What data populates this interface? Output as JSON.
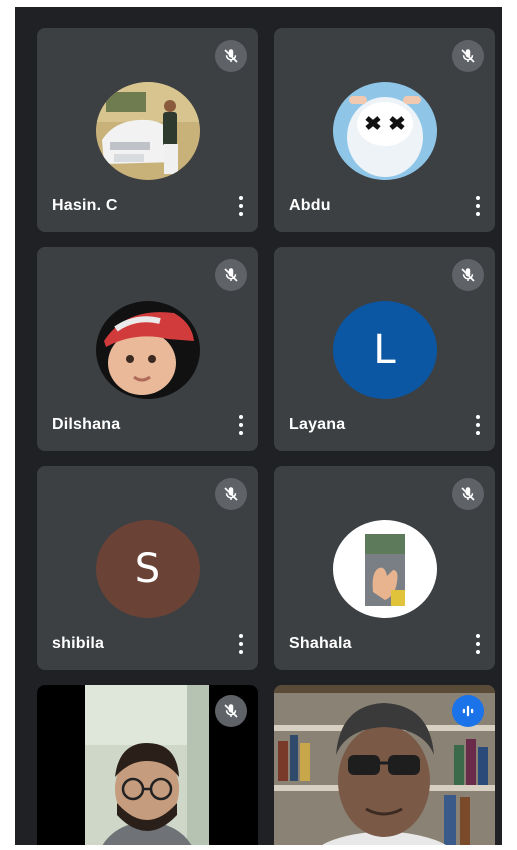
{
  "participants": [
    {
      "name": "Hasin. C",
      "avatar": "photo-car",
      "mic": "muted"
    },
    {
      "name": "Abdu",
      "avatar": "photo-marshmello",
      "mic": "muted"
    },
    {
      "name": "Dilshana",
      "avatar": "photo-baby",
      "mic": "muted"
    },
    {
      "name": "Layana",
      "avatar": "L",
      "avatar_color": "#0b57a4",
      "mic": "muted"
    },
    {
      "name": "shibila",
      "avatar": "S",
      "avatar_color": "#6b4236",
      "mic": "muted"
    },
    {
      "name": "Shahala",
      "avatar": "photo-hand",
      "mic": "muted"
    },
    {
      "name": "",
      "avatar": "video-young-man",
      "mic": "muted"
    },
    {
      "name": "",
      "avatar": "video-older-man",
      "mic": "speaking"
    }
  ],
  "icons": {
    "muted": "mic-off-icon",
    "speaking": "audio-level-icon",
    "menu": "more-vert-icon"
  },
  "colors": {
    "background": "#202124",
    "tile": "#3c4043",
    "mic_badge": "#5f6368",
    "speaking_badge": "#1a73e8"
  }
}
